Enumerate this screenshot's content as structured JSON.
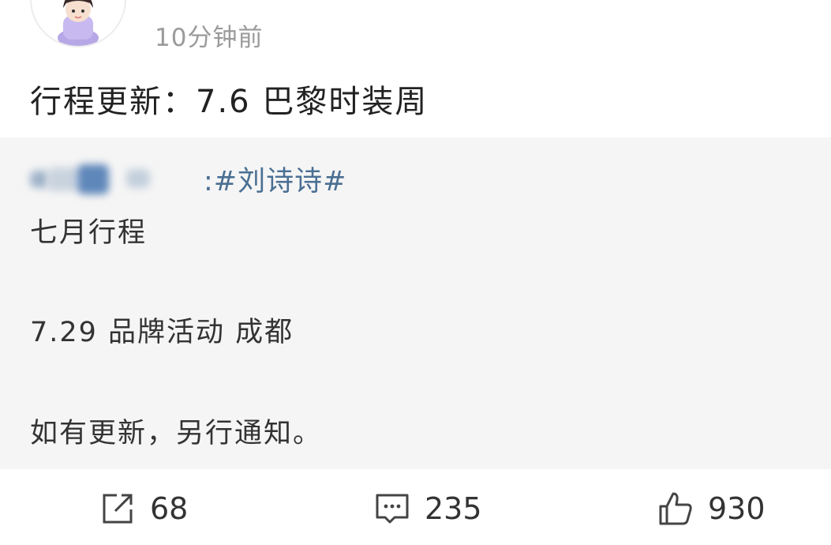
{
  "post": {
    "avatar_icon": "girl-avatar-icon",
    "timestamp": "10分钟前",
    "text": "行程更新：7.6 巴黎时装周"
  },
  "repost": {
    "hashtag": ":#刘诗诗#",
    "line1": "七月行程",
    "line2": "7.29 品牌活动 成都",
    "line3": "如有更新，另行通知。"
  },
  "actions": {
    "share_icon": "share-icon",
    "share_count": "68",
    "comment_icon": "comment-icon",
    "comment_count": "235",
    "like_icon": "thumbs-up-icon",
    "like_count": "930"
  },
  "colors": {
    "hashtag": "#4a6f93",
    "repost_bg": "#f5f5f5",
    "timestamp": "#9a9a9a"
  }
}
